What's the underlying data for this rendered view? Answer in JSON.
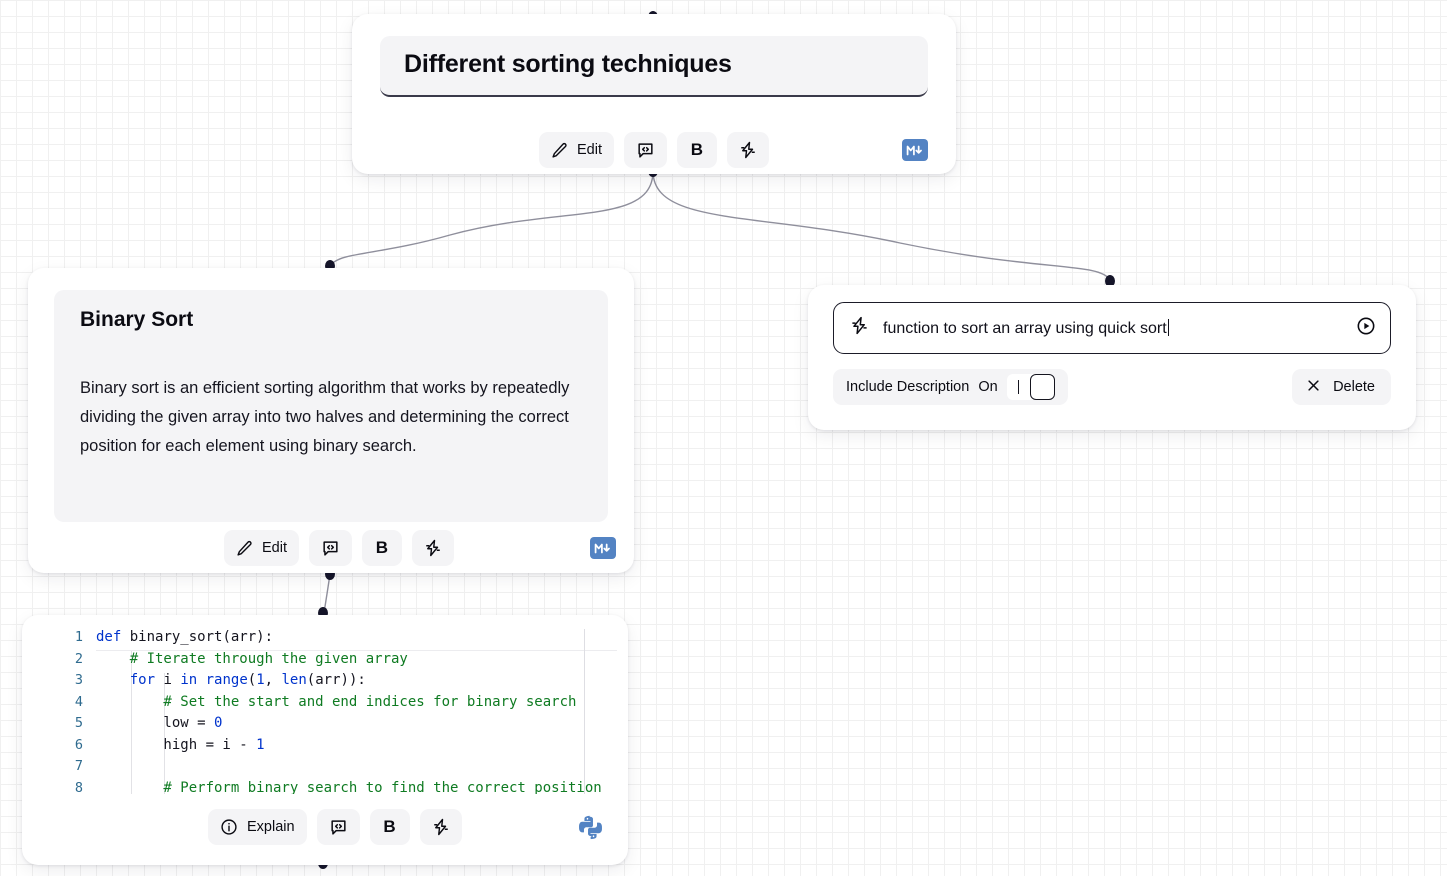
{
  "canvas": {
    "background": "#ffffff",
    "grid_color": "#f0f0f0",
    "edge_color": "#8f8f9c",
    "port_color": "#16162a"
  },
  "nodes": {
    "title_node": {
      "title_value": "Different sorting techniques",
      "toolbar": {
        "edit_label": "Edit",
        "comment_icon": "code-comment-icon",
        "bold_label": "B",
        "lightning_icon": "lightning-bolt-icon",
        "markdown_badge": "markdown-icon",
        "markdown_badge_color": "#5383c3"
      }
    },
    "binary_sort_node": {
      "heading": "Binary Sort",
      "body": "Binary sort is an efficient sorting algorithm that works by repeatedly dividing the given array into two halves and determining the correct position for each element using binary search.",
      "toolbar": {
        "edit_label": "Edit",
        "comment_icon": "code-comment-icon",
        "bold_label": "B",
        "lightning_icon": "lightning-bolt-icon",
        "markdown_badge": "markdown-icon",
        "markdown_badge_color": "#5383c3"
      }
    },
    "prompt_node": {
      "input_value": "function to sort an array using quick sort",
      "input_icon": "lightning-bolt-icon",
      "run_icon": "play-circle-icon",
      "include_description_label": "Include Description",
      "include_description_state": "On",
      "delete_label": "Delete",
      "delete_icon": "close-x-icon"
    },
    "code_node": {
      "language": "python",
      "language_icon": "python-logo-icon",
      "line_numbers": [
        "1",
        "2",
        "3",
        "4",
        "5",
        "6",
        "7",
        "8"
      ],
      "lines": [
        "def binary_sort(arr):",
        "    # Iterate through the given array",
        "    for i in range(1, len(arr)):",
        "        # Set the start and end indices for binary search",
        "        low = 0",
        "        high = i - 1",
        "",
        "        # Perform binary search to find the correct position"
      ],
      "toolbar": {
        "explain_label": "Explain",
        "explain_icon": "info-circle-icon",
        "comment_icon": "code-comment-icon",
        "bold_label": "B",
        "lightning_icon": "lightning-bolt-icon"
      }
    }
  },
  "syntax_colors": {
    "keyword": "#0033cc",
    "comment": "#0f7b22",
    "number": "#0033cc",
    "plain": "#15151f",
    "line_number": "#2f6b8f"
  }
}
